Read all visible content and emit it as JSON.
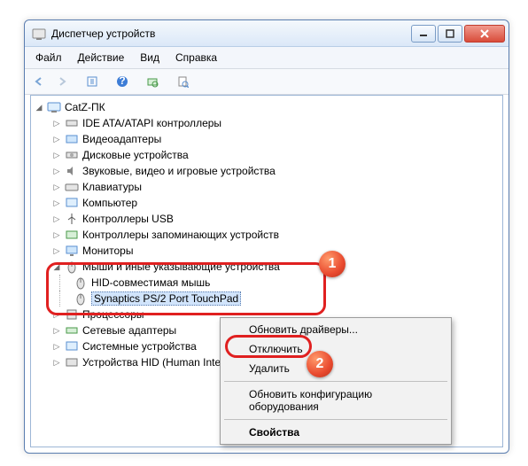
{
  "window": {
    "title": "Диспетчер устройств"
  },
  "menu": {
    "file": "Файл",
    "action": "Действие",
    "view": "Вид",
    "help": "Справка"
  },
  "tree": {
    "root": "CatZ-ПК",
    "items": [
      "IDE ATA/ATAPI контроллеры",
      "Видеоадаптеры",
      "Дисковые устройства",
      "Звуковые, видео и игровые устройства",
      "Клавиатуры",
      "Компьютер",
      "Контроллеры USB",
      "Контроллеры запоминающих устройств",
      "Мониторы"
    ],
    "mice_category": "Мыши и иные указывающие устройства",
    "mice_children": [
      "HID-совместимая мышь",
      "Synaptics PS/2 Port TouchPad"
    ],
    "items_after": [
      "Процессоры",
      "Сетевые адаптеры",
      "Системные устройства",
      "Устройства HID (Human Interface Devices)"
    ]
  },
  "context_menu": {
    "update_drivers": "Обновить драйверы...",
    "disable": "Отключить",
    "delete": "Удалить",
    "scan_hw": "Обновить конфигурацию оборудования",
    "properties": "Свойства"
  },
  "annotations": {
    "badge1": "1",
    "badge2": "2"
  }
}
